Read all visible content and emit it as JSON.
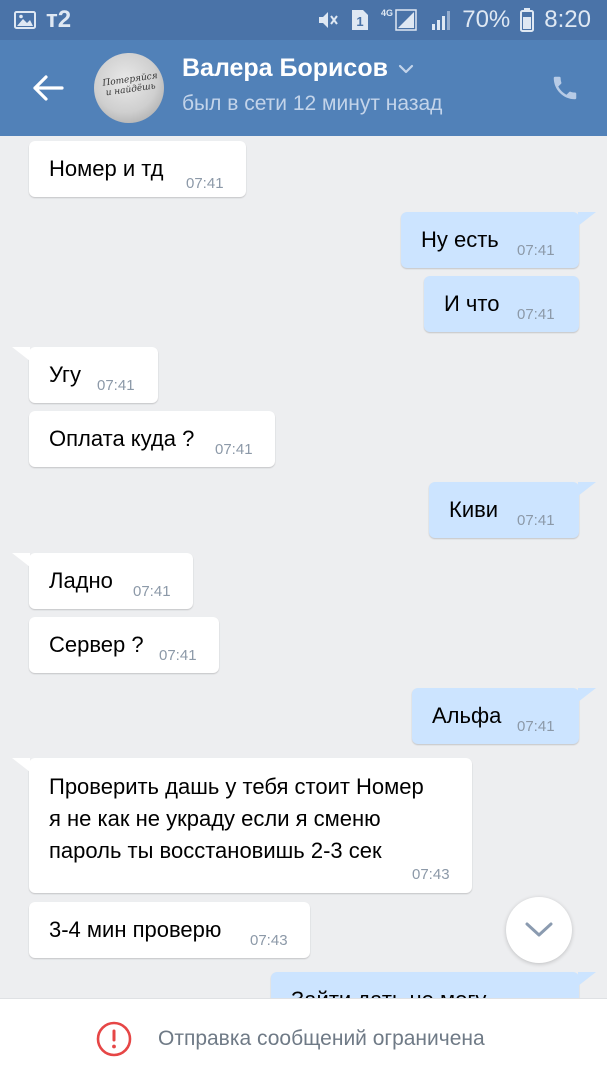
{
  "status_bar": {
    "carrier": "т2",
    "icons": [
      "image-icon",
      "mute-icon",
      "sim-1-icon",
      "4g-signal-icon",
      "signal-icon"
    ],
    "sim_label": "1",
    "network_label": "4G",
    "battery": "70%",
    "time": "8:20"
  },
  "header": {
    "contact_name": "Валера Борисов",
    "last_seen": "был в сети 12 минут назад",
    "avatar_text": "Потеряйся и найдёшь"
  },
  "messages": [
    {
      "dir": "in",
      "text": "Номер и тд",
      "time": "07:41"
    },
    {
      "dir": "out",
      "text": "Ну есть",
      "time": "07:41"
    },
    {
      "dir": "out",
      "text": "И что",
      "time": "07:41"
    },
    {
      "dir": "in",
      "text": "Угу",
      "time": "07:41"
    },
    {
      "dir": "in",
      "text": "Оплата куда ?",
      "time": "07:41"
    },
    {
      "dir": "out",
      "text": "Киви",
      "time": "07:41"
    },
    {
      "dir": "in",
      "text": "Ладно",
      "time": "07:41"
    },
    {
      "dir": "in",
      "text": "Сервер ?",
      "time": "07:41"
    },
    {
      "dir": "out",
      "text": "Альфа",
      "time": "07:41"
    },
    {
      "dir": "in",
      "lines": [
        "Проверить дашь у тебя стоит Номер",
        "я не как не украду если я сменю",
        "пароль ты восстановишь 2-3 сек"
      ],
      "time": "07:43"
    },
    {
      "dir": "in",
      "text": "3-4 мин проверю",
      "time": "07:43"
    },
    {
      "dir": "out",
      "text": "Зайти дать не могу",
      "time": ""
    }
  ],
  "bottom_bar": {
    "restriction_text": "Отправка сообщений ограничена"
  },
  "colors": {
    "header_bg": "#5181b8",
    "status_bar_bg": "#4a73a8",
    "chat_bg": "#edeef0",
    "outgoing_bubble": "#cce4ff",
    "incoming_bubble": "#ffffff",
    "restriction_icon": "#e64646"
  }
}
